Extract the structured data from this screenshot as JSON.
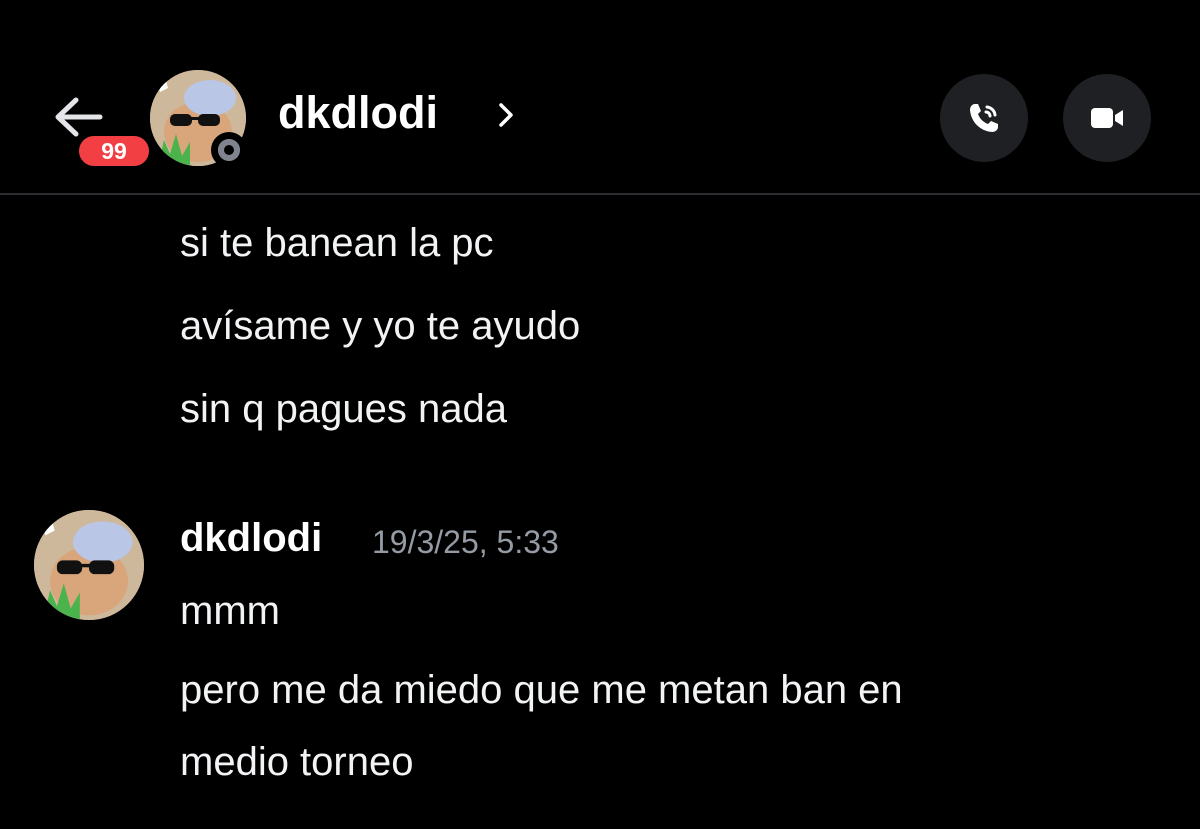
{
  "header": {
    "unread_count": "99",
    "channel_name": "dkdlodi",
    "chevron_glyph": "›",
    "status": "offline",
    "call_icon": "phone-icon",
    "video_icon": "video-camera-icon"
  },
  "messages": {
    "group1": {
      "lines": [
        "si te banean la pc",
        "avísame y yo te ayudo",
        "sin q pagues nada"
      ]
    },
    "group2": {
      "author": "dkdlodi",
      "timestamp": "19/3/25, 5:33",
      "lines": [
        "mmm",
        "pero me da miedo que me metan ban en",
        "medio torneo"
      ]
    }
  },
  "colors": {
    "background": "#000000",
    "badge": "#f23f43",
    "button_bg": "#1f2023",
    "text": "#f2f3f5",
    "muted": "#949ba4"
  }
}
